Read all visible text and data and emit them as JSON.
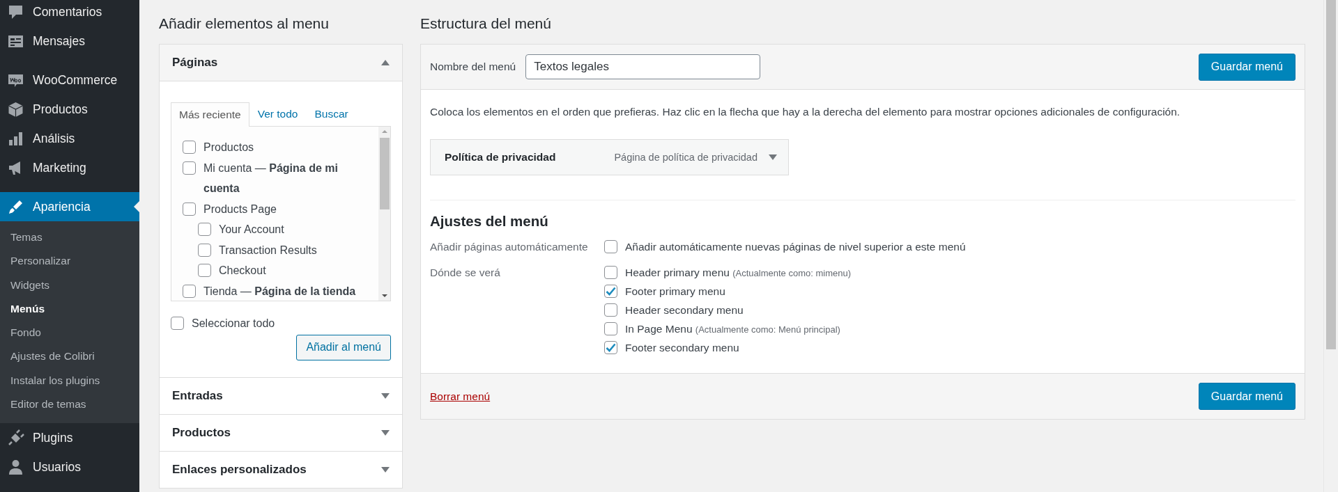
{
  "sidebar": {
    "groups": [
      [
        {
          "label": "Comentarios",
          "selected": false
        },
        {
          "label": "Mensajes",
          "selected": false
        }
      ],
      [
        {
          "label": "WooCommerce",
          "selected": false
        },
        {
          "label": "Productos",
          "selected": false
        },
        {
          "label": "Análisis",
          "selected": false
        },
        {
          "label": "Marketing",
          "selected": false
        }
      ],
      [
        {
          "label": "Apariencia",
          "selected": true,
          "children": [
            {
              "label": "Temas",
              "selected": false
            },
            {
              "label": "Personalizar",
              "selected": false
            },
            {
              "label": "Widgets",
              "selected": false
            },
            {
              "label": "Menús",
              "selected": true
            },
            {
              "label": "Fondo",
              "selected": false
            },
            {
              "label": "Ajustes de Colibri",
              "selected": false
            },
            {
              "label": "Instalar los plugins",
              "selected": false
            },
            {
              "label": "Editor de temas",
              "selected": false
            }
          ]
        },
        {
          "label": "Plugins",
          "selected": false
        },
        {
          "label": "Usuarios",
          "selected": false
        }
      ]
    ]
  },
  "add_items": {
    "title": "Añadir elementos al menu",
    "sections": [
      {
        "title": "Páginas",
        "expanded": true,
        "tabs": [
          {
            "label": "Más reciente",
            "selected": true
          },
          {
            "label": "Ver todo",
            "selected": false
          },
          {
            "label": "Buscar",
            "selected": false
          }
        ],
        "items": [
          {
            "label": "Productos",
            "checked": false
          },
          {
            "label": "Mi cuenta — **Página de mi cuenta**",
            "checked": false
          },
          {
            "label": "Products Page",
            "checked": false,
            "children": [
              {
                "label": "Your Account",
                "checked": false
              },
              {
                "label": "Transaction Results",
                "checked": false
              },
              {
                "label": "Checkout",
                "checked": false
              }
            ]
          },
          {
            "label": "Tienda — **Página de la tienda**",
            "checked": false
          }
        ],
        "select_all": {
          "label": "Seleccionar todo",
          "checked": false
        },
        "button": "Añadir al menú"
      },
      {
        "title": "Entradas",
        "expanded": false
      },
      {
        "title": "Productos",
        "expanded": false
      },
      {
        "title": "Enlaces personalizados",
        "expanded": false
      }
    ]
  },
  "menu_structure": {
    "title": "Estructura del menú",
    "name_label": "Nombre del menú",
    "name_value": "Textos legales",
    "save_button": "Guardar menú",
    "instructions": "Coloca los elementos en el orden que prefieras. Haz clic en la flecha que hay a la derecha del elemento para mostrar opciones adicionales de configuración.",
    "menu_items": [
      {
        "title": "Política de privacidad",
        "type": "Página de política de privacidad"
      }
    ],
    "settings": {
      "title": "Ajustes del menú",
      "rows": [
        {
          "label": "Añadir páginas automáticamente",
          "options": [
            {
              "label": "Añadir automáticamente nuevas páginas de nivel superior a este menú",
              "checked": false
            }
          ]
        },
        {
          "label": "Dónde se verá",
          "options": [
            {
              "label": "Header primary menu",
              "note": "(Actualmente como: mimenu)",
              "checked": false
            },
            {
              "label": "Footer primary menu",
              "checked": true
            },
            {
              "label": "Header secondary menu",
              "checked": false
            },
            {
              "label": "In Page Menu",
              "note": "(Actualmente como: Menú principal)",
              "checked": false
            },
            {
              "label": "Footer secondary menu",
              "checked": true
            }
          ]
        }
      ]
    },
    "delete_link": "Borrar menú",
    "footer_save_button": "Guardar menú"
  }
}
